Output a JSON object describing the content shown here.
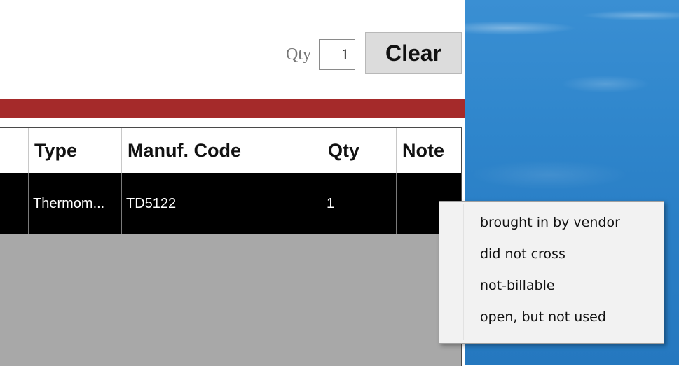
{
  "toolbar": {
    "qty_label": "Qty",
    "qty_value": "1",
    "clear_label": "Clear"
  },
  "grid": {
    "columns": [
      "Type",
      "Manuf. Code",
      "Qty",
      "Note"
    ],
    "rows": [
      [
        "Thermom...",
        "TD5122",
        "1",
        ""
      ]
    ]
  },
  "context_menu": {
    "items": [
      "brought in by vendor",
      "did not cross",
      "not-billable",
      "open, but not used"
    ]
  },
  "colors": {
    "accent_bar": "#a52a2a",
    "selected_row": "#000000",
    "grid_empty": "#a8a8a8",
    "desktop_sky": "#2f86cc"
  }
}
